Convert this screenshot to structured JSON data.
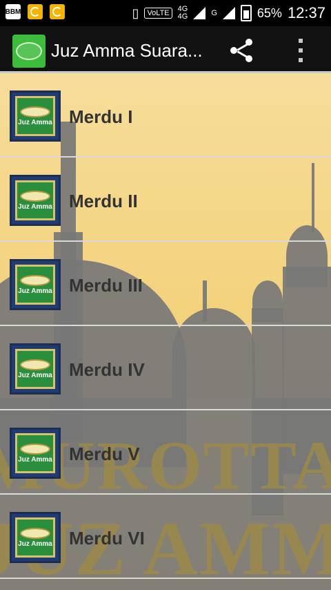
{
  "status_bar": {
    "battery": "65%",
    "time": "12:37",
    "network": "4G",
    "network_lower": "4G",
    "volte": "VoLTE",
    "carrier_g": "G",
    "bbm_label": "BBM"
  },
  "action_bar": {
    "title": "Juz Amma Suara...",
    "share_icon": "share-icon",
    "overflow_icon": "more-vert-icon"
  },
  "list": {
    "items": [
      {
        "label": "Merdu I",
        "thumb_text": "Juz Amma"
      },
      {
        "label": "Merdu II",
        "thumb_text": "Juz Amma"
      },
      {
        "label": "Merdu III",
        "thumb_text": "Juz Amma"
      },
      {
        "label": "Merdu IV",
        "thumb_text": "Juz Amma"
      },
      {
        "label": "Merdu V",
        "thumb_text": "Juz Amma"
      },
      {
        "label": "Merdu VI",
        "thumb_text": "Juz Amma"
      }
    ]
  },
  "background_text": {
    "line1": "MUROTTAL",
    "line2": "JUZ AMMA"
  },
  "colors": {
    "action_bar": "#121212",
    "content_bg": "#f2cf73",
    "label_text": "#333333",
    "thumb_border": "#1f3c76"
  }
}
